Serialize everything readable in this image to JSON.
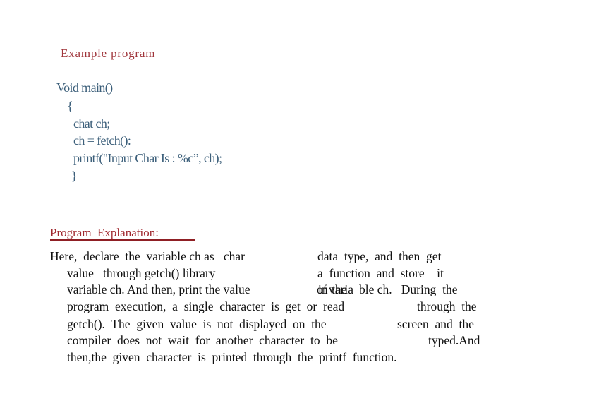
{
  "heading": "Example program",
  "code": {
    "lines": [
      "Void main()",
      "{",
      "chat ch;",
      "ch = fetch():",
      "printf(\"Input Char Is : %c”, ch);",
      "}"
    ]
  },
  "explanation": {
    "title": "Program  Explanation:",
    "lines": [
      {
        "left": "Here,  declare  the  variable ch as   char",
        "right": "data  type,  and  then  get"
      },
      {
        "left": "value   through getch() library",
        "right": "a  function  and  store    it"
      },
      {
        "left": "variable ch. And then, print the value",
        "overlap_a": "of",
        "overlap_b": "in",
        "overlap_c": "the",
        "overlap_d": "varia",
        "right": "ble ch.   During  the"
      },
      {
        "left": "program  execution,  a  single  character  is  get  or  read",
        "right": "through  the"
      },
      {
        "left": "getch().  The  given  value  is  not  displayed  on  the",
        "right": "screen  and  the"
      },
      {
        "left": "compiler  does  not  wait  for  another  character  to  be",
        "right": "typed.And"
      },
      {
        "left": "then,the  given  character  is  printed  through  the  printf  function.",
        "right": ""
      }
    ]
  }
}
